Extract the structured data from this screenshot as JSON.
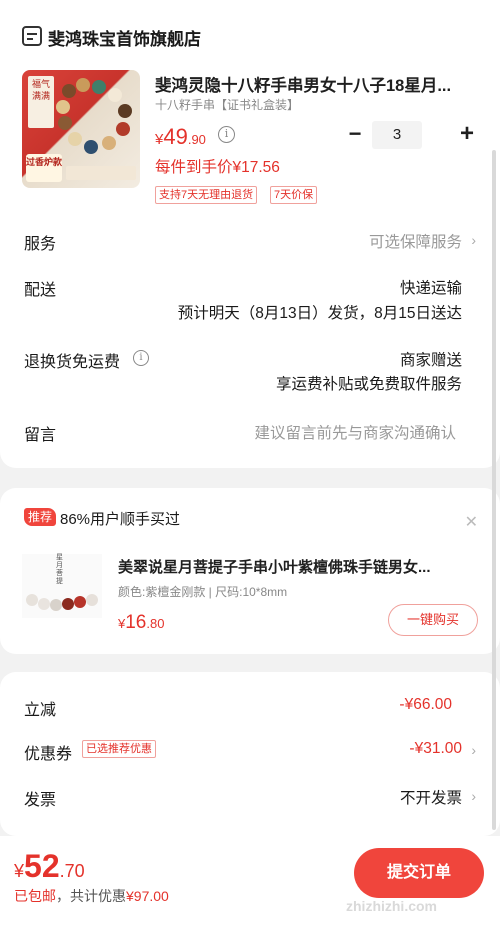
{
  "store": {
    "name": "斐鸿珠宝首饰旗舰店"
  },
  "product": {
    "title": "斐鸿灵隐十八籽手串男女十八子18星月...",
    "sku": "十八籽手串【证书礼盒装】",
    "price_currency": "¥",
    "price_int": "49",
    "price_dec": ".90",
    "quantity": "3",
    "per_item_price": "每件到手价¥17.56",
    "chips": [
      "支持7天无理由退货",
      "7天价保"
    ],
    "image_text": {
      "top_tag": "福气满满",
      "badge": "过香炉款"
    }
  },
  "rows": {
    "service": {
      "label": "服务",
      "value": "可选保障服务"
    },
    "delivery": {
      "label": "配送",
      "value1": "快递运输",
      "value2": "预计明天（8月13日）发货，8月15日送达"
    },
    "return": {
      "label": "退换货免运费",
      "value1": "商家赠送",
      "value2": "享运费补贴或免费取件服务"
    },
    "note": {
      "label": "留言",
      "placeholder": "建议留言前先与商家沟通确认"
    }
  },
  "recommend": {
    "tag": "推荐",
    "headline": "86%用户顺手买过",
    "title": "美翠说星月菩提子手串小叶紫檀佛珠手链男女...",
    "spec": "颜色:紫檀金刚款 | 尺码:10*8mm",
    "price_currency": "¥",
    "price_int": "16",
    "price_dec": ".80",
    "buy_label": "一键购买",
    "image_label": "星月菩提"
  },
  "summary": {
    "discount": {
      "label": "立减",
      "value": "-¥66.00"
    },
    "coupon": {
      "label": "优惠券",
      "tag": "已选推荐优惠",
      "value": "-¥31.00"
    },
    "invoice": {
      "label": "发票",
      "value": "不开发票"
    }
  },
  "footer": {
    "total_currency": "¥",
    "total_int": "52",
    "total_dec": ".70",
    "shipping": "已包邮",
    "saving": "，共计优惠",
    "saving_value": "¥97.00",
    "submit_label": "提交订单"
  },
  "watermark": "zhizhizhi.com",
  "colors": {
    "accent": "#e4322b",
    "button": "#f0453c"
  },
  "icons": [
    "store-icon",
    "info-icon",
    "chevron-right-icon",
    "close-icon"
  ]
}
